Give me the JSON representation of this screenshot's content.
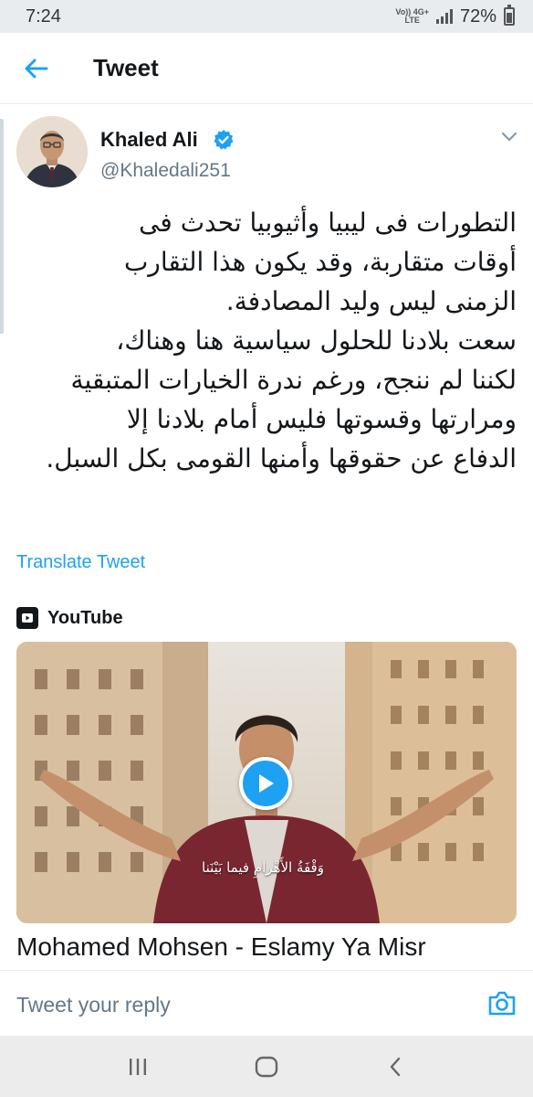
{
  "status_bar": {
    "time": "7:24",
    "network_top": "Vo)) 4G+",
    "network_bottom": "LTE",
    "battery": "72%"
  },
  "header": {
    "title": "Tweet",
    "back_icon": "arrow-left-icon"
  },
  "tweet": {
    "author_name": "Khaled Ali",
    "handle": "@Khaledali251",
    "verified": true,
    "text_lines": [
      "التطورات فى ليبيا وأثيوبيا تحدث فى",
      "أوقات متقاربة، وقد يكون هذا التقارب",
      "الزمنى ليس وليد المصادفة.",
      "سعت بلادنا للحلول سياسية هنا وهناك،",
      "لكننا لم ننجح، ورغم ندرة الخيارات المتبقية",
      "ومرارتها وقسوتها فليس أمام بلادنا إلا",
      "الدفاع عن حقوقها وأمنها القومى بكل السبل."
    ],
    "translate_label": "Translate Tweet"
  },
  "card": {
    "source": "YouTube",
    "subtitle": "وَقْفَةُ الأَهْرامِ فيما بَيْنَنا",
    "video_title": "Mohamed Mohsen - Eslamy Ya Misr"
  },
  "reply": {
    "placeholder": "Tweet your reply",
    "camera_icon": "camera-icon"
  },
  "nav": {
    "recents_icon": "recents-icon",
    "home_icon": "home-icon",
    "back_icon": "back-chevron-icon"
  },
  "colors": {
    "accent": "#1da1f2",
    "text": "#14171a",
    "secondary": "#657786"
  }
}
